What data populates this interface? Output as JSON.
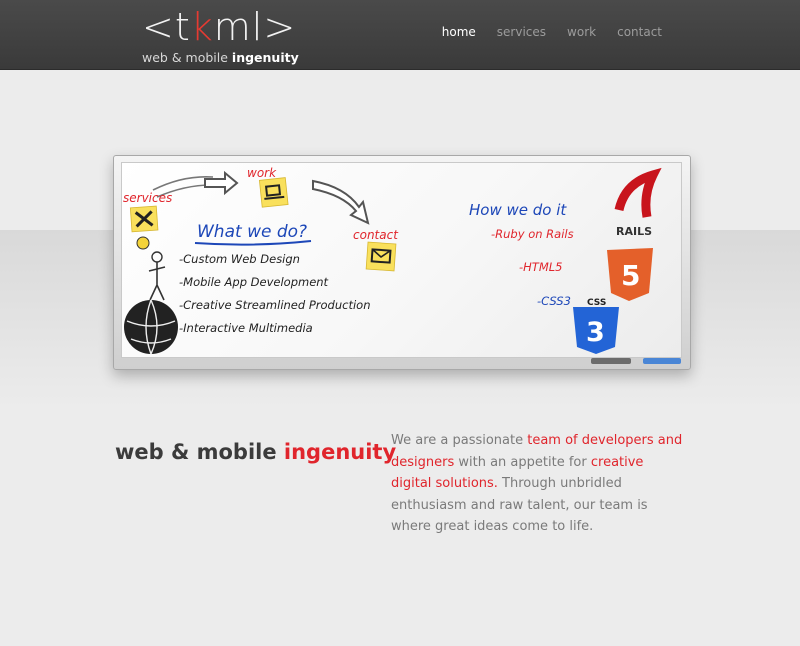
{
  "header": {
    "logo_mark_left": "<t",
    "logo_mark_k": "k",
    "logo_mark_right": "ml>",
    "tagline_regular": "web & mobile",
    "tagline_bold": "ingenuity",
    "nav": [
      {
        "label": "home",
        "active": true
      },
      {
        "label": "services",
        "active": false
      },
      {
        "label": "work",
        "active": false
      },
      {
        "label": "contact",
        "active": false
      }
    ]
  },
  "whiteboard": {
    "note_services": "services",
    "note_work": "work",
    "note_contact": "contact",
    "what_title": "What we do?",
    "what_items": [
      "-Custom Web Design",
      "-Mobile App Development",
      "-Creative Streamlined Production",
      "-Interactive Multimedia"
    ],
    "how_title": "How we do it",
    "how_items": [
      "-Ruby on Rails",
      "-HTML5",
      "-CSS3"
    ],
    "rails_label": "RAILS",
    "css_label": "CSS"
  },
  "intro": {
    "headline_regular": "web & mobile",
    "headline_bold": "ingenuity",
    "p1": "We are a passionate ",
    "p2": "team of developers and designers",
    "p3": " with an appetite for ",
    "p4": "creative digital solutions.",
    "p5": " Through unbridled enthusiasm and raw talent, our team is where great ideas come to life."
  },
  "colors": {
    "accent_red": "#e0252c",
    "topbar": "#404040",
    "background": "#ececec",
    "marker_blue": "#1d47b8",
    "sticky_yellow": "#f9e05c"
  }
}
